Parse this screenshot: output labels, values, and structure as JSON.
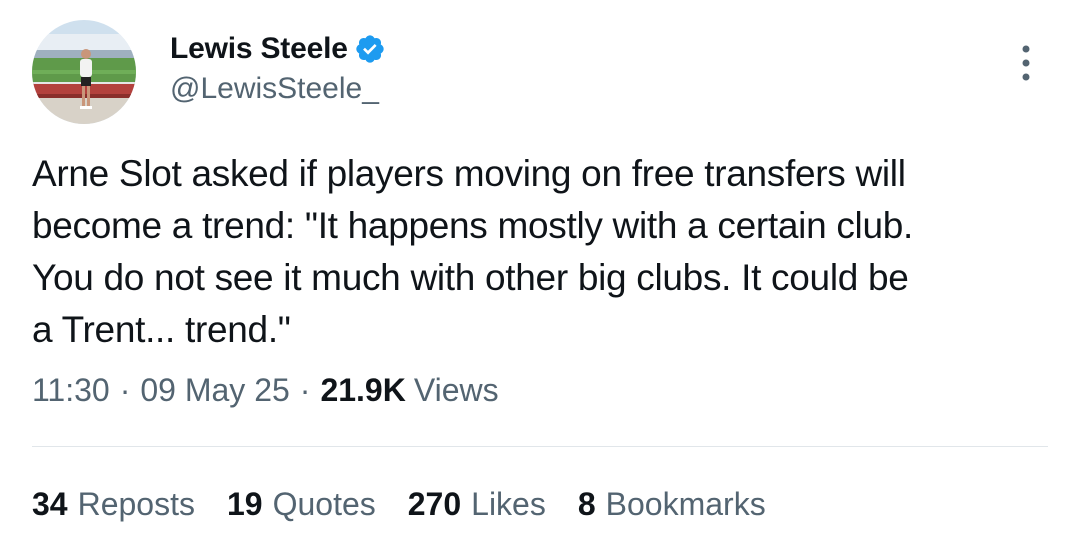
{
  "author": {
    "name": "Lewis Steele",
    "handle": "@LewisSteele_",
    "verified": true,
    "avatar_icon": "profile-photo-stadium"
  },
  "more_icon": "more-vertical-icon",
  "tweet": {
    "text": "Arne Slot asked if players moving on free transfers will\nbecome a trend: \"It happens mostly with a certain club.\nYou do not see it much with other big clubs. It could be\na Trent... trend.\""
  },
  "meta": {
    "time": "11:30",
    "separator": "·",
    "date": "09 May 25",
    "views_count": "21.9K",
    "views_label": "Views"
  },
  "stats": {
    "reposts_count": "34",
    "reposts_label": "Reposts",
    "quotes_count": "19",
    "quotes_label": "Quotes",
    "likes_count": "270",
    "likes_label": "Likes",
    "bookmarks_count": "8",
    "bookmarks_label": "Bookmarks"
  },
  "colors": {
    "text_primary": "#0f1419",
    "text_secondary": "#536471",
    "verified_blue": "#1d9bf0",
    "divider": "#e1e6ea"
  }
}
